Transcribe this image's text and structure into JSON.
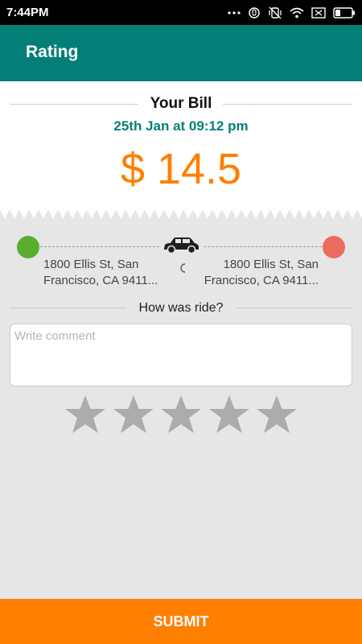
{
  "status_bar": {
    "time": "7:44PM",
    "icons": [
      "more-icon",
      "mute-icon",
      "vibrate-icon",
      "wifi-icon",
      "sim-icon",
      "battery-icon"
    ]
  },
  "app_bar": {
    "title": "Rating",
    "color": "#047f78"
  },
  "bill": {
    "title": "Your Bill",
    "date": "25th Jan at 09:12 pm",
    "amount": "$ 14.5",
    "amount_color": "#ff7f00"
  },
  "route": {
    "start_address": "1800 Ellis St, San Francisco, CA 9411...",
    "end_address": "1800 Ellis St, San Francisco, CA 9411...",
    "start_color": "#5aae2e",
    "end_color": "#ec6b5f",
    "icon": "car-icon"
  },
  "feedback": {
    "question": "How was ride?",
    "comment_placeholder": "Write comment",
    "comment_value": "",
    "rating": 0,
    "max_rating": 5
  },
  "submit_label": "SUBMIT"
}
